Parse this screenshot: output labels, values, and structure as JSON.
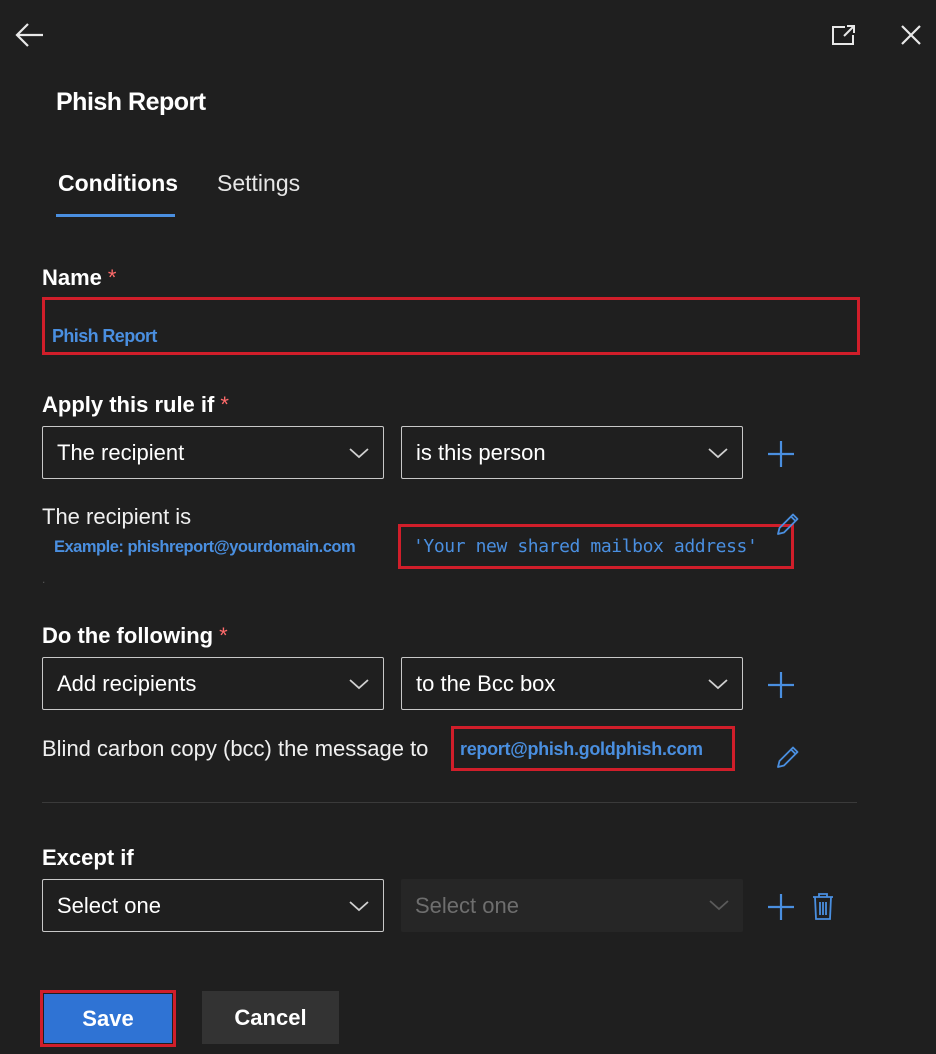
{
  "header": {
    "back_icon": "arrow-left-icon",
    "popout_icon": "open-in-new-window-icon",
    "close_icon": "close-icon"
  },
  "panel": {
    "title": "Phish Report"
  },
  "tabs": [
    {
      "label": "Conditions",
      "active": true
    },
    {
      "label": "Settings",
      "active": false
    }
  ],
  "name_section": {
    "label": "Name",
    "required_mark": "*",
    "value": "Phish Report"
  },
  "apply_section": {
    "label": "Apply this rule if",
    "required_mark": "*",
    "condition_select": "The recipient",
    "operator_select": "is this person",
    "detail_text": "The recipient is",
    "example_text": "Example: phishreport@yourdomain.com",
    "value_text": "'Your new shared mailbox address'",
    "dot": "."
  },
  "do_section": {
    "label": "Do the following",
    "required_mark": "*",
    "action_select": "Add recipients",
    "target_select": "to the Bcc box",
    "detail_text": "Blind carbon copy (bcc) the message to",
    "value_text": "report@phish.goldphish.com"
  },
  "except_section": {
    "label": "Except if",
    "first_select": "Select one",
    "second_select": "Select one"
  },
  "footer": {
    "save_label": "Save",
    "cancel_label": "Cancel"
  },
  "colors": {
    "background": "#1f1f1f",
    "accent": "#4a8fe0",
    "annotation_red": "#d01e2a",
    "save_button": "#2f73d4",
    "cancel_button": "#333333"
  }
}
